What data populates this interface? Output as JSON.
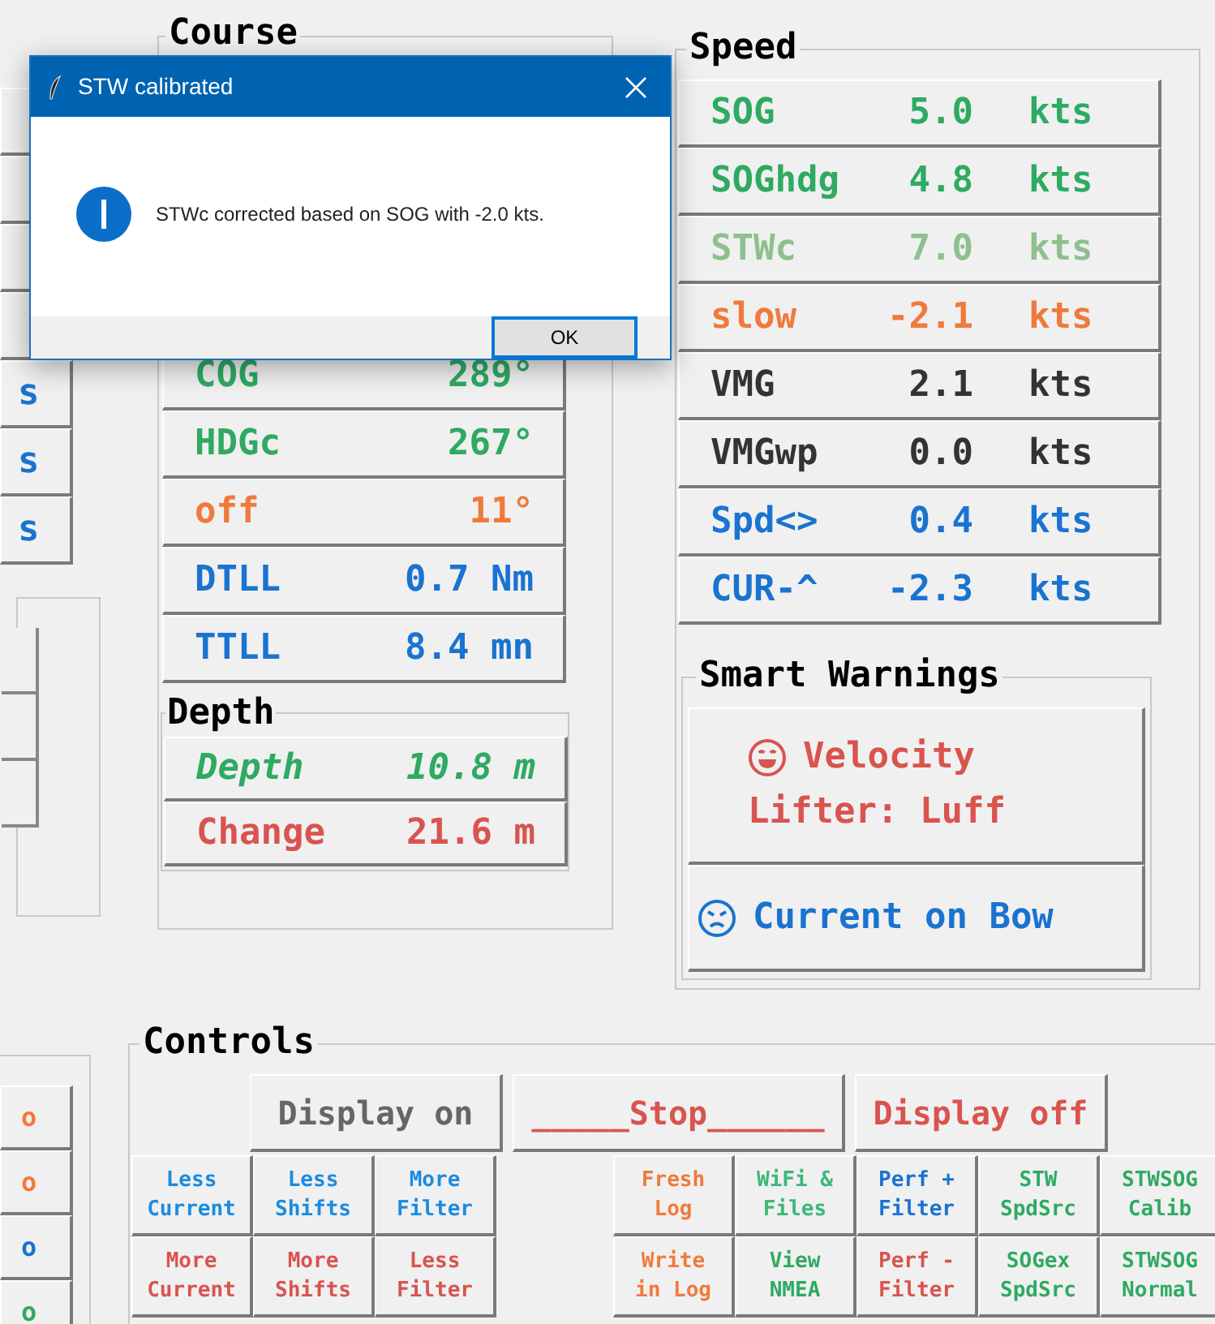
{
  "dialog": {
    "title": "STW calibrated",
    "message": "STWc corrected based on SOG with -2.0 kts.",
    "button": "OK"
  },
  "left_panel": {
    "buttons": [
      {
        "text": "s",
        "color": "#1a73d0"
      },
      {
        "text": "s",
        "color": "#1a73d0"
      },
      {
        "text": "s",
        "color": "#1a73d0"
      }
    ]
  },
  "left_bottom": {
    "buttons": [
      {
        "text": "o",
        "color": "#f07a3c"
      },
      {
        "text": "o",
        "color": "#f07a3c"
      },
      {
        "text": "o",
        "color": "#1a73d0"
      },
      {
        "text": "o",
        "color": "#2eaa62"
      }
    ]
  },
  "course": {
    "title": "Course",
    "rows": [
      {
        "label": "COG",
        "value": "289°",
        "color": "#2eaa62"
      },
      {
        "label": "HDGc",
        "value": "267°",
        "color": "#2eaa62"
      },
      {
        "label": "off",
        "value": "11°",
        "color": "#f07a3c"
      },
      {
        "label": "DTLL",
        "value": "0.7 Nm",
        "color": "#1a73d0"
      },
      {
        "label": "TTLL",
        "value": "8.4 mn",
        "color": "#1a73d0"
      }
    ]
  },
  "depth": {
    "title": "Depth",
    "rows": [
      {
        "label": "Depth",
        "value": "10.8 m",
        "color": "#2eaa62",
        "italic": true
      },
      {
        "label": "Change",
        "value": "21.6 m",
        "color": "#d9534f",
        "italic": false
      }
    ]
  },
  "speed": {
    "title": "Speed",
    "rows": [
      {
        "label": "SOG",
        "value": "5.0",
        "unit": "kts",
        "color": "#2eaa62"
      },
      {
        "label": "SOGhdg",
        "value": "4.8",
        "unit": "kts",
        "color": "#2eaa62"
      },
      {
        "label": "STWc",
        "value": "7.0",
        "unit": "kts",
        "color": "#8fbf8f"
      },
      {
        "label": "slow",
        "value": "-2.1",
        "unit": "kts",
        "color": "#f07a3c"
      },
      {
        "label": "VMG",
        "value": "2.1",
        "unit": "kts",
        "color": "#333333"
      },
      {
        "label": "VMGwp",
        "value": "0.0",
        "unit": "kts",
        "color": "#333333"
      },
      {
        "label": "Spd<>",
        "value": "0.4",
        "unit": "kts",
        "color": "#1a73d0"
      },
      {
        "label": "CUR-^",
        "value": "-2.3",
        "unit": "kts",
        "color": "#1a73d0"
      }
    ]
  },
  "smart_warnings": {
    "title": "Smart Warnings",
    "items": [
      {
        "kind": "happy",
        "text": "Velocity\nLifter: Luff",
        "color": "#d9534f"
      },
      {
        "kind": "angry",
        "text": "Current on Bow",
        "color": "#1a73d0"
      }
    ]
  },
  "controls": {
    "title": "Controls",
    "top_buttons": [
      {
        "text": "Display on",
        "color": "#666666"
      },
      {
        "text": "_____Stop______",
        "color": "#d9534f"
      },
      {
        "text": "Display off",
        "color": "#d9534f"
      }
    ],
    "left_grid": [
      [
        {
          "text": "Less\nCurrent",
          "color": "#1a8ce0"
        },
        {
          "text": "Less\nShifts",
          "color": "#1a8ce0"
        },
        {
          "text": "More\nFilter",
          "color": "#1a8ce0"
        }
      ],
      [
        {
          "text": "More\nCurrent",
          "color": "#d9534f"
        },
        {
          "text": "More\nShifts",
          "color": "#d9534f"
        },
        {
          "text": "Less\nFilter",
          "color": "#d9534f"
        }
      ]
    ],
    "right_grid": [
      [
        {
          "text": "Fresh\nLog",
          "color": "#f07a3c"
        },
        {
          "text": "WiFi &\nFiles",
          "color": "#3cb878"
        },
        {
          "text": "Perf +\nFilter",
          "color": "#1a73d0"
        },
        {
          "text": "STW\nSpdSrc",
          "color": "#2eaa62"
        },
        {
          "text": "STWSOG\nCalib",
          "color": "#2eaa62"
        }
      ],
      [
        {
          "text": "Write\nin Log",
          "color": "#f07a3c"
        },
        {
          "text": "View\nNMEA",
          "color": "#2eaa62"
        },
        {
          "text": "Perf -\nFilter",
          "color": "#d9534f"
        },
        {
          "text": "SOGex\nSpdSrc",
          "color": "#2eaa62"
        },
        {
          "text": "STWSOG\nNormal",
          "color": "#2eaa62"
        }
      ]
    ]
  }
}
